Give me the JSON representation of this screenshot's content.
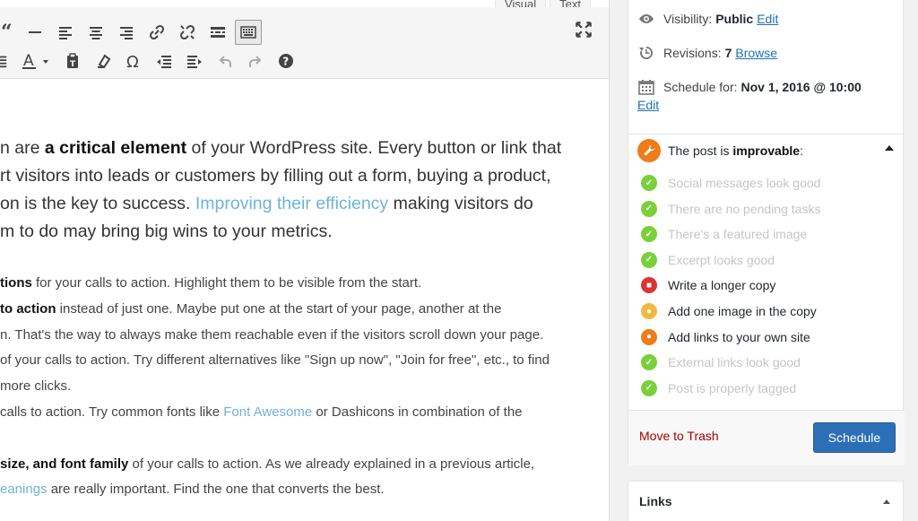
{
  "editor": {
    "tabs": [
      "Visual",
      "Text"
    ],
    "intro_lines": [
      {
        "pre": "n are ",
        "bold": "a critical element",
        "post": " of your WordPress site. Every button or link that"
      },
      {
        "pre": "rt visitors into leads or customers by filling out a form, buying a product,"
      },
      {
        "pre": "on is the key to success. ",
        "link": "Improving their efficiency",
        "post": " making visitors do"
      },
      {
        "pre": "m to do may bring big wins to your metrics."
      }
    ],
    "list_lines": [
      {
        "bold": "tions",
        "post": " for your calls to action. Highlight them to be visible from the start."
      },
      {
        "bold": "to action",
        "post": " instead of just one. Maybe put one at the start of your page, another at the"
      },
      {
        "pre": "n. That's the way to always make them reachable even if the visitors scroll down your page."
      },
      {
        "pre": "of your calls to action. Try different alternatives like \"Sign up now\", \"Join for free\", etc., to find"
      },
      {
        "pre": "more clicks."
      },
      {
        "pre": "calls to action. Try common fonts like ",
        "link": "Font Awesome",
        "post": " or Dashicons in combination of the"
      },
      {
        "pre": ""
      },
      {
        "bold": " size, and font family",
        "post": " of your calls to action. As we already explained in a previous article,"
      },
      {
        "link": "eanings",
        "post": " are really important. Find the one that converts the best."
      }
    ]
  },
  "publish": {
    "visibility_label": "Visibility:",
    "visibility_value": "Public",
    "visibility_edit": "Edit",
    "revisions_label": "Revisions:",
    "revisions_value": "7",
    "revisions_browse": "Browse",
    "schedule_label": "Schedule for:",
    "schedule_value": "Nov 1, 2016 @ 10:00",
    "schedule_edit": "Edit",
    "seo_title_pre": "The post is ",
    "seo_title_bold": "improvable",
    "seo_title_post": ":",
    "checks": [
      {
        "label": "Social messages look good",
        "status": "good",
        "color": "#7ad03a"
      },
      {
        "label": "There are no pending tasks",
        "status": "good",
        "color": "#7ad03a"
      },
      {
        "label": "There's a featured image",
        "status": "good",
        "color": "#7ad03a"
      },
      {
        "label": "Excerpt looks good",
        "status": "good",
        "color": "#7ad03a"
      },
      {
        "label": "Write a longer copy",
        "status": "bad",
        "color": "#dc3232"
      },
      {
        "label": "Add one image in the copy",
        "status": "warn",
        "color": "#f0b840"
      },
      {
        "label": "Add links to your own site",
        "status": "warn",
        "color": "#ee7c1b"
      },
      {
        "label": "External links look good",
        "status": "good",
        "color": "#7ad03a"
      },
      {
        "label": "Post is properly tagged",
        "status": "good",
        "color": "#7ad03a"
      }
    ],
    "trash_label": "Move to Trash",
    "schedule_button": "Schedule"
  },
  "links_panel": {
    "title": "Links"
  },
  "icons": {
    "toolbar_row1": [
      "blockquote-icon",
      "horizontal-line-icon",
      "align-left-icon",
      "align-center-icon",
      "align-right-icon",
      "link-icon",
      "unlink-icon",
      "read-more-icon",
      "toolbar-toggle-icon"
    ],
    "toolbar_row2": [
      "justify-icon",
      "text-color-icon",
      "paste-text-icon",
      "clear-formatting-icon",
      "special-character-icon",
      "outdent-icon",
      "indent-icon",
      "undo-icon",
      "redo-icon",
      "help-icon"
    ]
  }
}
